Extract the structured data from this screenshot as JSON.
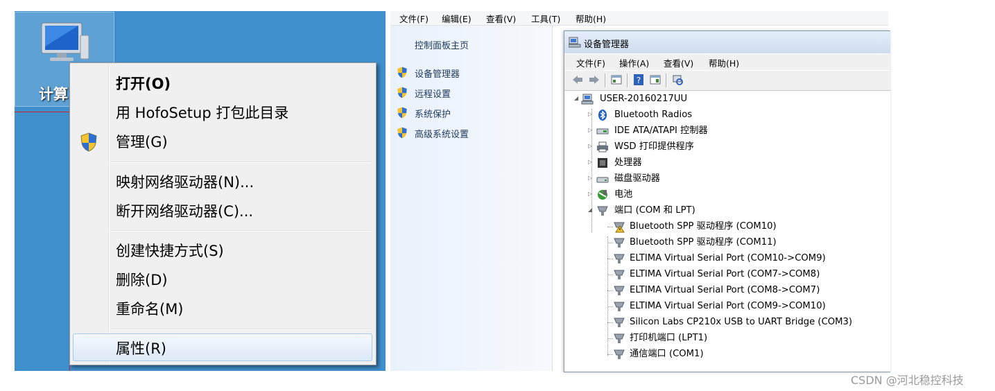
{
  "desktop": {
    "icon_label": "计算",
    "context_menu": {
      "items": [
        {
          "label": "打开(O)",
          "bold": true
        },
        {
          "label": "用 HofoSetup 打包此目录"
        },
        {
          "label": "管理(G)",
          "icon": "uac-shield-icon"
        },
        {
          "label": "映射网络驱动器(N)..."
        },
        {
          "label": "断开网络驱动器(C)..."
        },
        {
          "label": "创建快捷方式(S)"
        },
        {
          "label": "删除(D)"
        },
        {
          "label": "重命名(M)"
        },
        {
          "label": "属性(R)",
          "highlighted": true
        }
      ]
    }
  },
  "control_panel": {
    "menubar": [
      "文件(F)",
      "编辑(E)",
      "查看(V)",
      "工具(T)",
      "帮助(H)"
    ],
    "home_link": "控制面板主页",
    "links": [
      "设备管理器",
      "远程设置",
      "系统保护",
      "高级系统设置"
    ]
  },
  "device_manager": {
    "title": "设备管理器",
    "menubar": [
      "文件(F)",
      "操作(A)",
      "查看(V)",
      "帮助(H)"
    ],
    "toolbar_icons": [
      "back-arrow-icon",
      "forward-arrow-icon",
      "show-hide-tree-icon",
      "help-icon",
      "properties-icon",
      "scan-hardware-icon"
    ],
    "root": "USER-20160217UU",
    "categories": [
      {
        "label": "Bluetooth Radios",
        "icon": "bluetooth-icon"
      },
      {
        "label": "IDE ATA/ATAPI 控制器",
        "icon": "ide-controller-icon"
      },
      {
        "label": "WSD 打印提供程序",
        "icon": "printer-icon"
      },
      {
        "label": "处理器",
        "icon": "processor-icon"
      },
      {
        "label": "磁盘驱动器",
        "icon": "disk-drive-icon"
      },
      {
        "label": "电池",
        "icon": "battery-icon"
      },
      {
        "label": "端口 (COM 和 LPT)",
        "icon": "port-icon",
        "expanded": true
      }
    ],
    "ports": [
      {
        "label": "Bluetooth SPP 驱动程序 (COM10)",
        "warning": true
      },
      {
        "label": "Bluetooth SPP 驱动程序 (COM11)"
      },
      {
        "label": "ELTIMA Virtual Serial Port (COM10->COM9)"
      },
      {
        "label": "ELTIMA Virtual Serial Port (COM7->COM8)"
      },
      {
        "label": "ELTIMA Virtual Serial Port (COM8->COM7)"
      },
      {
        "label": "ELTIMA Virtual Serial Port (COM9->COM10)"
      },
      {
        "label": "Silicon Labs CP210x USB to UART Bridge (COM3)"
      },
      {
        "label": "打印机端口 (LPT1)"
      },
      {
        "label": "通信端口 (COM1)"
      }
    ]
  },
  "watermark": "CSDN @河北稳控科技"
}
